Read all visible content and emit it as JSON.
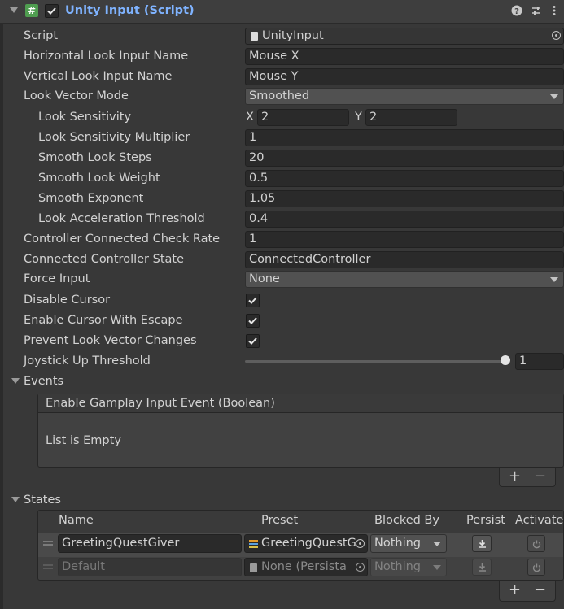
{
  "component": {
    "title": "Unity Input (Script)",
    "enabled": true
  },
  "fields": {
    "script": {
      "label": "Script",
      "value": "UnityInput"
    },
    "horizontal_look": {
      "label": "Horizontal Look Input Name",
      "value": "Mouse X"
    },
    "vertical_look": {
      "label": "Vertical Look Input Name",
      "value": "Mouse Y"
    },
    "look_vector_mode": {
      "label": "Look Vector Mode",
      "value": "Smoothed"
    },
    "look_sensitivity": {
      "label": "Look Sensitivity",
      "x_label": "X",
      "x": "2",
      "y_label": "Y",
      "y": "2"
    },
    "look_sensitivity_multiplier": {
      "label": "Look Sensitivity Multiplier",
      "value": "1"
    },
    "smooth_look_steps": {
      "label": "Smooth Look Steps",
      "value": "20"
    },
    "smooth_look_weight": {
      "label": "Smooth Look Weight",
      "value": "0.5"
    },
    "smooth_exponent": {
      "label": "Smooth Exponent",
      "value": "1.05"
    },
    "look_acceleration_threshold": {
      "label": "Look Acceleration Threshold",
      "value": "0.4"
    },
    "controller_check_rate": {
      "label": "Controller Connected Check Rate",
      "value": "1"
    },
    "connected_controller_state": {
      "label": "Connected Controller State",
      "value": "ConnectedController"
    },
    "force_input": {
      "label": "Force Input",
      "value": "None"
    },
    "disable_cursor": {
      "label": "Disable Cursor",
      "checked": true
    },
    "enable_cursor_escape": {
      "label": "Enable Cursor With Escape",
      "checked": true
    },
    "prevent_look_vector_changes": {
      "label": "Prevent Look Vector Changes",
      "checked": true
    },
    "joystick_up_threshold": {
      "label": "Joystick Up Threshold",
      "value": "1",
      "slider_fraction": 1.0
    }
  },
  "events": {
    "label": "Events",
    "event_header": "Enable Gamplay Input Event (Boolean)",
    "empty_text": "List is Empty",
    "add": "+",
    "remove": "−"
  },
  "states": {
    "label": "States",
    "columns": {
      "name": "Name",
      "preset": "Preset",
      "blocked_by": "Blocked By",
      "persist": "Persist",
      "activate": "Activate"
    },
    "rows": [
      {
        "name": "GreetingQuestGiver",
        "preset": "GreetingQuestG",
        "blocked_by": "Nothing"
      },
      {
        "name": "Default",
        "preset": "None (Persista",
        "blocked_by": "Nothing"
      }
    ],
    "add": "+",
    "remove": "−"
  },
  "colors": {
    "accent_title": "#7fb3ff",
    "script_icon": "#4f9d50",
    "background": "#383838"
  }
}
